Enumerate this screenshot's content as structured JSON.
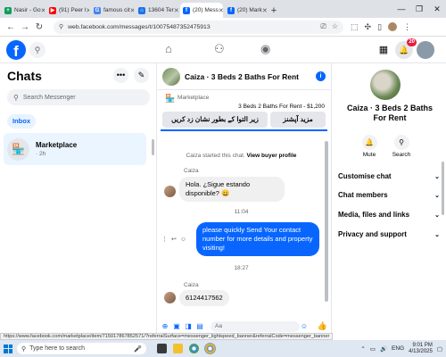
{
  "browser": {
    "tabs": [
      {
        "label": "Nasir - Go",
        "color": "#0f9d58",
        "glyph": "+",
        "active": false
      },
      {
        "label": "(91) Peer l",
        "color": "#ff0000",
        "glyph": "▶",
        "active": false
      },
      {
        "label": "famous cit",
        "color": "#4285f4",
        "glyph": "G",
        "active": false
      },
      {
        "label": "13604 Ter",
        "color": "#1a73e8",
        "glyph": "⌂",
        "active": false
      },
      {
        "label": "(20) Mess",
        "color": "#0866ff",
        "glyph": "f",
        "active": true
      },
      {
        "label": "(20) Mark",
        "color": "#0866ff",
        "glyph": "f",
        "active": false
      }
    ],
    "new_tab": "+",
    "url": "web.facebook.com/messages/t/10075487352475913"
  },
  "fb": {
    "logo": "f",
    "notification_count": "20"
  },
  "sidebar": {
    "title": "Chats",
    "more_glyph": "•••",
    "compose_glyph": "✎",
    "search_placeholder": "Search Messenger",
    "inbox_label": "Inbox",
    "conversation": {
      "name": "Marketplace",
      "time": "· 2h"
    }
  },
  "chat": {
    "title": "Caiza · 3 Beds 2 Baths For Rent",
    "marketplace_label": "Marketplace",
    "listing": "3 Beds 2 Baths For Rent - $1,200",
    "btn_more": "مزید آپشنز",
    "btn_mark": "زیر التوا کے بطور نشان زد کریں",
    "started_text": "Caiza started this chat.",
    "view_profile": "View buyer profile",
    "messages": [
      {
        "sender": "Caiza",
        "text": "Hola. ¿Sigue estando disponible? 😀"
      },
      {
        "time": "11:04"
      },
      {
        "out": "please quickly Send Your contact number for more details and property visiting!"
      },
      {
        "time": "18:27"
      },
      {
        "sender": "Caiza",
        "text": "6124417562"
      }
    ],
    "composer_placeholder": "Aa",
    "like": "👍"
  },
  "rpanel": {
    "title": "Caiza · 3 Beds 2 Baths For Rent",
    "mute_label": "Mute",
    "search_label": "Search",
    "sections": [
      "Customise chat",
      "Chat members",
      "Media, files and links",
      "Privacy and support"
    ]
  },
  "status_url": "https://www.facebook.com/marketplace/item/715017867852571/?referralSurface=messenger_lightspeed_banner&referralCode=messenger_banner",
  "taskbar": {
    "search_placeholder": "Type here to search",
    "lang": "ENG",
    "time": "9:01 PM",
    "date": "4/13/2025"
  }
}
